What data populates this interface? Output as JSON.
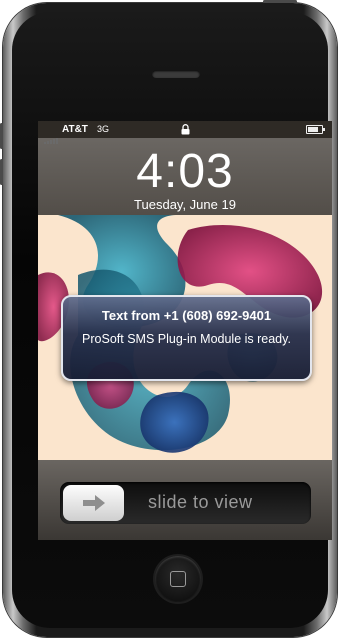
{
  "status_bar": {
    "carrier": "AT&T",
    "network": "3G",
    "battery_level": 0.8,
    "icons": [
      "signal-icon",
      "lock-icon",
      "battery-icon"
    ]
  },
  "lock_screen": {
    "time": "4:03",
    "date": "Tuesday, June 19"
  },
  "alert": {
    "title": "Text from +1 (608) 692-9401",
    "message": "ProSoft SMS Plug-in Module is ready."
  },
  "slider": {
    "label": "slide to view",
    "knob_icon": "arrow-right-icon"
  },
  "hardware": {
    "home_button_icon": "home-icon"
  },
  "colors": {
    "ink_pink": "#c2185b",
    "ink_teal": "#1f7f9a",
    "background_cream": "#fbe5cd"
  }
}
